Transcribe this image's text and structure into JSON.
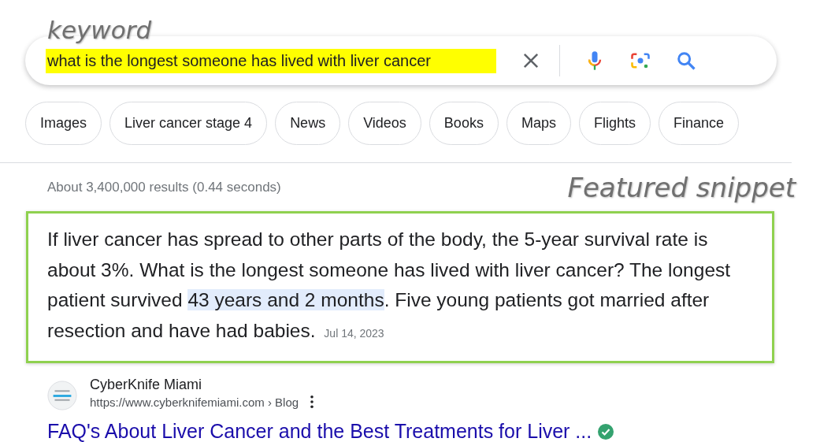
{
  "annotations": {
    "keyword": "keyword",
    "snippet": "Featured snippet"
  },
  "search": {
    "value": "what is the longest someone has lived with liver cancer",
    "highlighted": true
  },
  "chips": [
    "Images",
    "Liver cancer stage 4",
    "News",
    "Videos",
    "Books",
    "Maps",
    "Flights",
    "Finance"
  ],
  "results_count": "About 3,400,000 results (0.44 seconds)",
  "snippet": {
    "text_before": "If liver cancer has spread to other parts of the body, the 5-year survival rate is about 3%. What is the longest someone has lived with liver cancer? The longest patient survived ",
    "text_highlight": "43 years and 2 months",
    "text_after": ". Five young patients got married after resection and have had babies.",
    "date": "Jul 14, 2023"
  },
  "source": {
    "site_name": "CyberKnife Miami",
    "url": "https://www.cyberknifemiami.com › Blog",
    "title": "FAQ's About Liver Cancer and the Best Treatments for Liver ...",
    "verified": true
  }
}
